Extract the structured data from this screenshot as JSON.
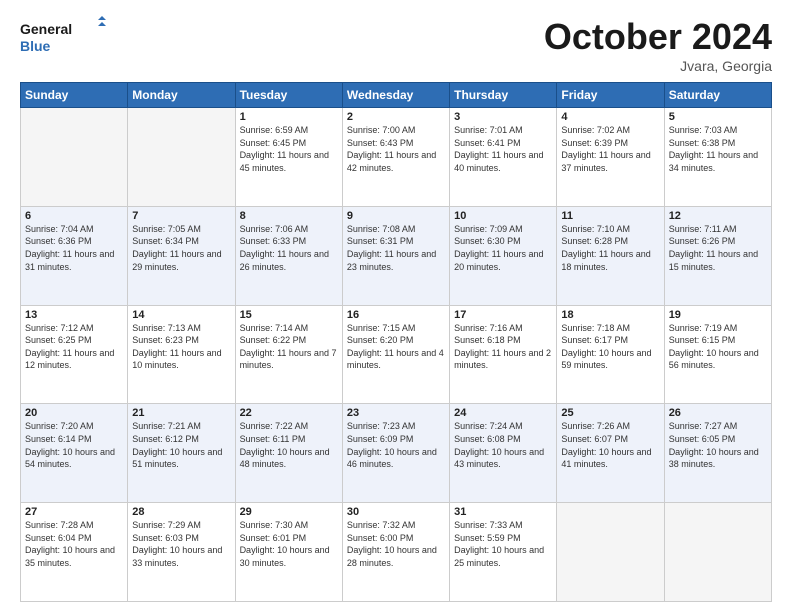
{
  "logo": {
    "line1": "General",
    "line2": "Blue"
  },
  "title": "October 2024",
  "location": "Jvara, Georgia",
  "days_of_week": [
    "Sunday",
    "Monday",
    "Tuesday",
    "Wednesday",
    "Thursday",
    "Friday",
    "Saturday"
  ],
  "weeks": [
    [
      {
        "day": "",
        "sunrise": "",
        "sunset": "",
        "daylight": ""
      },
      {
        "day": "",
        "sunrise": "",
        "sunset": "",
        "daylight": ""
      },
      {
        "day": "1",
        "sunrise": "Sunrise: 6:59 AM",
        "sunset": "Sunset: 6:45 PM",
        "daylight": "Daylight: 11 hours and 45 minutes."
      },
      {
        "day": "2",
        "sunrise": "Sunrise: 7:00 AM",
        "sunset": "Sunset: 6:43 PM",
        "daylight": "Daylight: 11 hours and 42 minutes."
      },
      {
        "day": "3",
        "sunrise": "Sunrise: 7:01 AM",
        "sunset": "Sunset: 6:41 PM",
        "daylight": "Daylight: 11 hours and 40 minutes."
      },
      {
        "day": "4",
        "sunrise": "Sunrise: 7:02 AM",
        "sunset": "Sunset: 6:39 PM",
        "daylight": "Daylight: 11 hours and 37 minutes."
      },
      {
        "day": "5",
        "sunrise": "Sunrise: 7:03 AM",
        "sunset": "Sunset: 6:38 PM",
        "daylight": "Daylight: 11 hours and 34 minutes."
      }
    ],
    [
      {
        "day": "6",
        "sunrise": "Sunrise: 7:04 AM",
        "sunset": "Sunset: 6:36 PM",
        "daylight": "Daylight: 11 hours and 31 minutes."
      },
      {
        "day": "7",
        "sunrise": "Sunrise: 7:05 AM",
        "sunset": "Sunset: 6:34 PM",
        "daylight": "Daylight: 11 hours and 29 minutes."
      },
      {
        "day": "8",
        "sunrise": "Sunrise: 7:06 AM",
        "sunset": "Sunset: 6:33 PM",
        "daylight": "Daylight: 11 hours and 26 minutes."
      },
      {
        "day": "9",
        "sunrise": "Sunrise: 7:08 AM",
        "sunset": "Sunset: 6:31 PM",
        "daylight": "Daylight: 11 hours and 23 minutes."
      },
      {
        "day": "10",
        "sunrise": "Sunrise: 7:09 AM",
        "sunset": "Sunset: 6:30 PM",
        "daylight": "Daylight: 11 hours and 20 minutes."
      },
      {
        "day": "11",
        "sunrise": "Sunrise: 7:10 AM",
        "sunset": "Sunset: 6:28 PM",
        "daylight": "Daylight: 11 hours and 18 minutes."
      },
      {
        "day": "12",
        "sunrise": "Sunrise: 7:11 AM",
        "sunset": "Sunset: 6:26 PM",
        "daylight": "Daylight: 11 hours and 15 minutes."
      }
    ],
    [
      {
        "day": "13",
        "sunrise": "Sunrise: 7:12 AM",
        "sunset": "Sunset: 6:25 PM",
        "daylight": "Daylight: 11 hours and 12 minutes."
      },
      {
        "day": "14",
        "sunrise": "Sunrise: 7:13 AM",
        "sunset": "Sunset: 6:23 PM",
        "daylight": "Daylight: 11 hours and 10 minutes."
      },
      {
        "day": "15",
        "sunrise": "Sunrise: 7:14 AM",
        "sunset": "Sunset: 6:22 PM",
        "daylight": "Daylight: 11 hours and 7 minutes."
      },
      {
        "day": "16",
        "sunrise": "Sunrise: 7:15 AM",
        "sunset": "Sunset: 6:20 PM",
        "daylight": "Daylight: 11 hours and 4 minutes."
      },
      {
        "day": "17",
        "sunrise": "Sunrise: 7:16 AM",
        "sunset": "Sunset: 6:18 PM",
        "daylight": "Daylight: 11 hours and 2 minutes."
      },
      {
        "day": "18",
        "sunrise": "Sunrise: 7:18 AM",
        "sunset": "Sunset: 6:17 PM",
        "daylight": "Daylight: 10 hours and 59 minutes."
      },
      {
        "day": "19",
        "sunrise": "Sunrise: 7:19 AM",
        "sunset": "Sunset: 6:15 PM",
        "daylight": "Daylight: 10 hours and 56 minutes."
      }
    ],
    [
      {
        "day": "20",
        "sunrise": "Sunrise: 7:20 AM",
        "sunset": "Sunset: 6:14 PM",
        "daylight": "Daylight: 10 hours and 54 minutes."
      },
      {
        "day": "21",
        "sunrise": "Sunrise: 7:21 AM",
        "sunset": "Sunset: 6:12 PM",
        "daylight": "Daylight: 10 hours and 51 minutes."
      },
      {
        "day": "22",
        "sunrise": "Sunrise: 7:22 AM",
        "sunset": "Sunset: 6:11 PM",
        "daylight": "Daylight: 10 hours and 48 minutes."
      },
      {
        "day": "23",
        "sunrise": "Sunrise: 7:23 AM",
        "sunset": "Sunset: 6:09 PM",
        "daylight": "Daylight: 10 hours and 46 minutes."
      },
      {
        "day": "24",
        "sunrise": "Sunrise: 7:24 AM",
        "sunset": "Sunset: 6:08 PM",
        "daylight": "Daylight: 10 hours and 43 minutes."
      },
      {
        "day": "25",
        "sunrise": "Sunrise: 7:26 AM",
        "sunset": "Sunset: 6:07 PM",
        "daylight": "Daylight: 10 hours and 41 minutes."
      },
      {
        "day": "26",
        "sunrise": "Sunrise: 7:27 AM",
        "sunset": "Sunset: 6:05 PM",
        "daylight": "Daylight: 10 hours and 38 minutes."
      }
    ],
    [
      {
        "day": "27",
        "sunrise": "Sunrise: 7:28 AM",
        "sunset": "Sunset: 6:04 PM",
        "daylight": "Daylight: 10 hours and 35 minutes."
      },
      {
        "day": "28",
        "sunrise": "Sunrise: 7:29 AM",
        "sunset": "Sunset: 6:03 PM",
        "daylight": "Daylight: 10 hours and 33 minutes."
      },
      {
        "day": "29",
        "sunrise": "Sunrise: 7:30 AM",
        "sunset": "Sunset: 6:01 PM",
        "daylight": "Daylight: 10 hours and 30 minutes."
      },
      {
        "day": "30",
        "sunrise": "Sunrise: 7:32 AM",
        "sunset": "Sunset: 6:00 PM",
        "daylight": "Daylight: 10 hours and 28 minutes."
      },
      {
        "day": "31",
        "sunrise": "Sunrise: 7:33 AM",
        "sunset": "Sunset: 5:59 PM",
        "daylight": "Daylight: 10 hours and 25 minutes."
      },
      {
        "day": "",
        "sunrise": "",
        "sunset": "",
        "daylight": ""
      },
      {
        "day": "",
        "sunrise": "",
        "sunset": "",
        "daylight": ""
      }
    ]
  ]
}
